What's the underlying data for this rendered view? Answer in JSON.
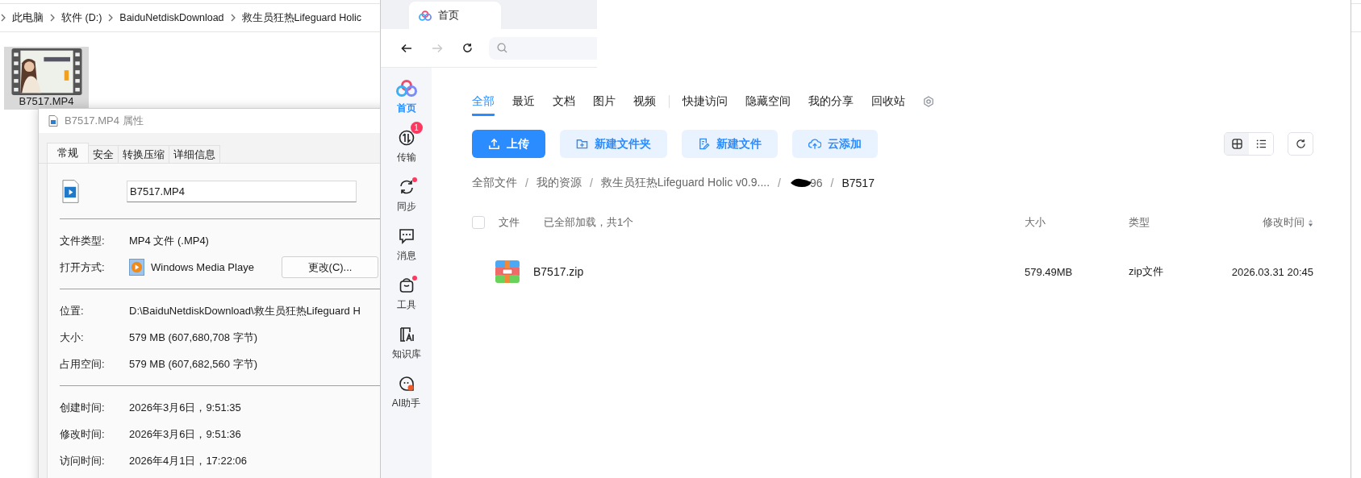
{
  "explorer": {
    "breadcrumb": [
      "此电脑",
      "软件 (D:)",
      "BaiduNetdiskDownload",
      "救生员狂热Lifeguard Holic"
    ],
    "files": [
      {
        "name": "B7517.MP4",
        "selected": true
      }
    ]
  },
  "properties": {
    "title": "B7517.MP4 属性",
    "tabs": [
      {
        "label": "常规",
        "selected": true
      },
      {
        "label": "安全",
        "selected": false
      },
      {
        "label": "转换压缩",
        "selected": false
      },
      {
        "label": "详细信息",
        "selected": false
      }
    ],
    "file_name": "B7517.MP4",
    "sections": [
      [
        {
          "kind": "text",
          "label": "文件类型:",
          "value": "MP4 文件 (.MP4)"
        },
        {
          "kind": "app",
          "label": "打开方式:",
          "value": "Windows Media Playe",
          "button": "更改(C)..."
        }
      ],
      [
        {
          "kind": "text",
          "label": "位置:",
          "value": "D:\\BaiduNetdiskDownload\\救生员狂热Lifeguard H"
        },
        {
          "kind": "text",
          "label": "大小:",
          "value": "579 MB (607,680,708 字节)"
        },
        {
          "kind": "text",
          "label": "占用空间:",
          "value": "579 MB (607,682,560 字节)"
        }
      ],
      [
        {
          "kind": "text",
          "label": "创建时间:",
          "value": "2026年3月6日，9:51:35"
        },
        {
          "kind": "text",
          "label": "修改时间:",
          "value": "2026年3月6日，9:51:36"
        },
        {
          "kind": "text",
          "label": "访问时间:",
          "value": "2026年4月1日，17:22:06"
        }
      ]
    ]
  },
  "netdisk": {
    "tab_title": "首页",
    "sidebar": [
      {
        "label": "首页",
        "selected": true,
        "dot": false
      },
      {
        "label": "传输",
        "selected": false,
        "badge": "1",
        "dot": false
      },
      {
        "label": "同步",
        "selected": false,
        "dot": true
      },
      {
        "label": "消息",
        "selected": false,
        "dot": false
      },
      {
        "label": "工具",
        "selected": false,
        "dot": true
      },
      {
        "label": "知识库",
        "selected": false,
        "dot": false
      },
      {
        "label": "AI助手",
        "selected": false,
        "dot": false
      }
    ],
    "categories": [
      {
        "label": "全部",
        "selected": true
      },
      {
        "label": "最近",
        "selected": false
      },
      {
        "label": "文档",
        "selected": false
      },
      {
        "label": "图片",
        "selected": false
      },
      {
        "label": "视频",
        "selected": false
      },
      {
        "label": "快捷访问",
        "selected": false
      },
      {
        "label": "隐藏空间",
        "selected": false
      },
      {
        "label": "我的分享",
        "selected": false
      },
      {
        "label": "回收站",
        "selected": false
      }
    ],
    "actions": [
      {
        "label": "上传",
        "kind": "primary"
      },
      {
        "label": "新建文件夹",
        "kind": "secondary"
      },
      {
        "label": "新建文件",
        "kind": "secondary"
      },
      {
        "label": "云添加",
        "kind": "secondary"
      }
    ],
    "view_modes": [
      {
        "selected": true
      },
      {
        "selected": false
      }
    ],
    "breadcrumb": [
      {
        "label": "全部文件",
        "redacted": false
      },
      {
        "separator": "/",
        "label": "我的资源",
        "redacted": false
      },
      {
        "separator": "/",
        "label": "救生员狂热Lifeguard Holic v0.9....",
        "redacted": false
      },
      {
        "separator": "/",
        "label": "96",
        "redacted": true
      },
      {
        "separator": "/",
        "label": "B7517",
        "redacted": false
      }
    ],
    "columns": {
      "all_checked": false,
      "name": "文件",
      "status": "已全部加载，共1个",
      "size": "大小",
      "type": "类型",
      "modified": "修改时间"
    },
    "rows": [
      {
        "name": "B7517.zip",
        "size": "579.49MB",
        "type": "zip文件",
        "modified": "2026.03.31 20:45",
        "checked": false
      }
    ]
  }
}
